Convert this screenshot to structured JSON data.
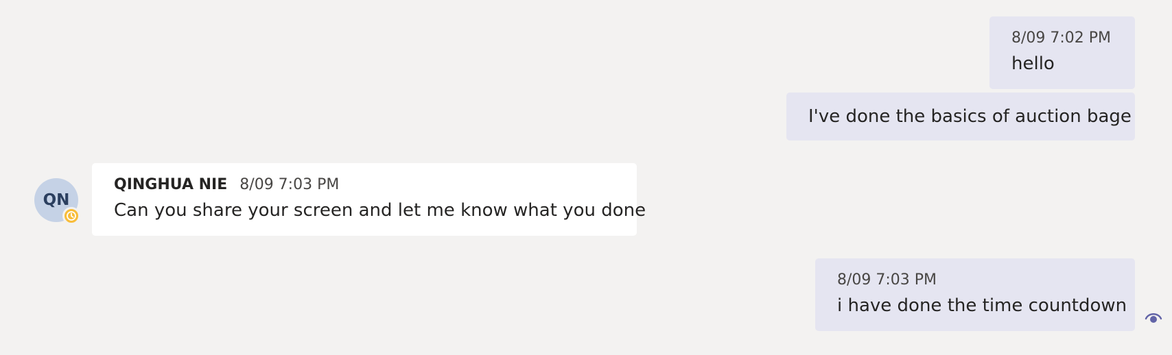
{
  "messages": [
    {
      "direction": "sent",
      "timestamp": "8/09 7:02 PM",
      "text": "hello"
    },
    {
      "direction": "sent",
      "text": "I've done the basics of auction bage"
    },
    {
      "direction": "received",
      "sender": "QINGHUA NIE",
      "timestamp": "8/09 7:03 PM",
      "text": "Can you share your screen and let me know what you done",
      "avatar_initials": "QN",
      "presence_icon": "clock-icon",
      "presence_color": "#f8bd3a"
    },
    {
      "direction": "sent",
      "timestamp": "8/09 7:03 PM",
      "text": "i have done the time countdown",
      "read_receipt_icon": "eye-icon"
    }
  ],
  "colors": {
    "background": "#f3f2f1",
    "sent_bubble": "#e5e5f1",
    "received_bubble": "#ffffff",
    "avatar_bg": "#c5d2e6",
    "read_receipt": "#6264a7"
  }
}
